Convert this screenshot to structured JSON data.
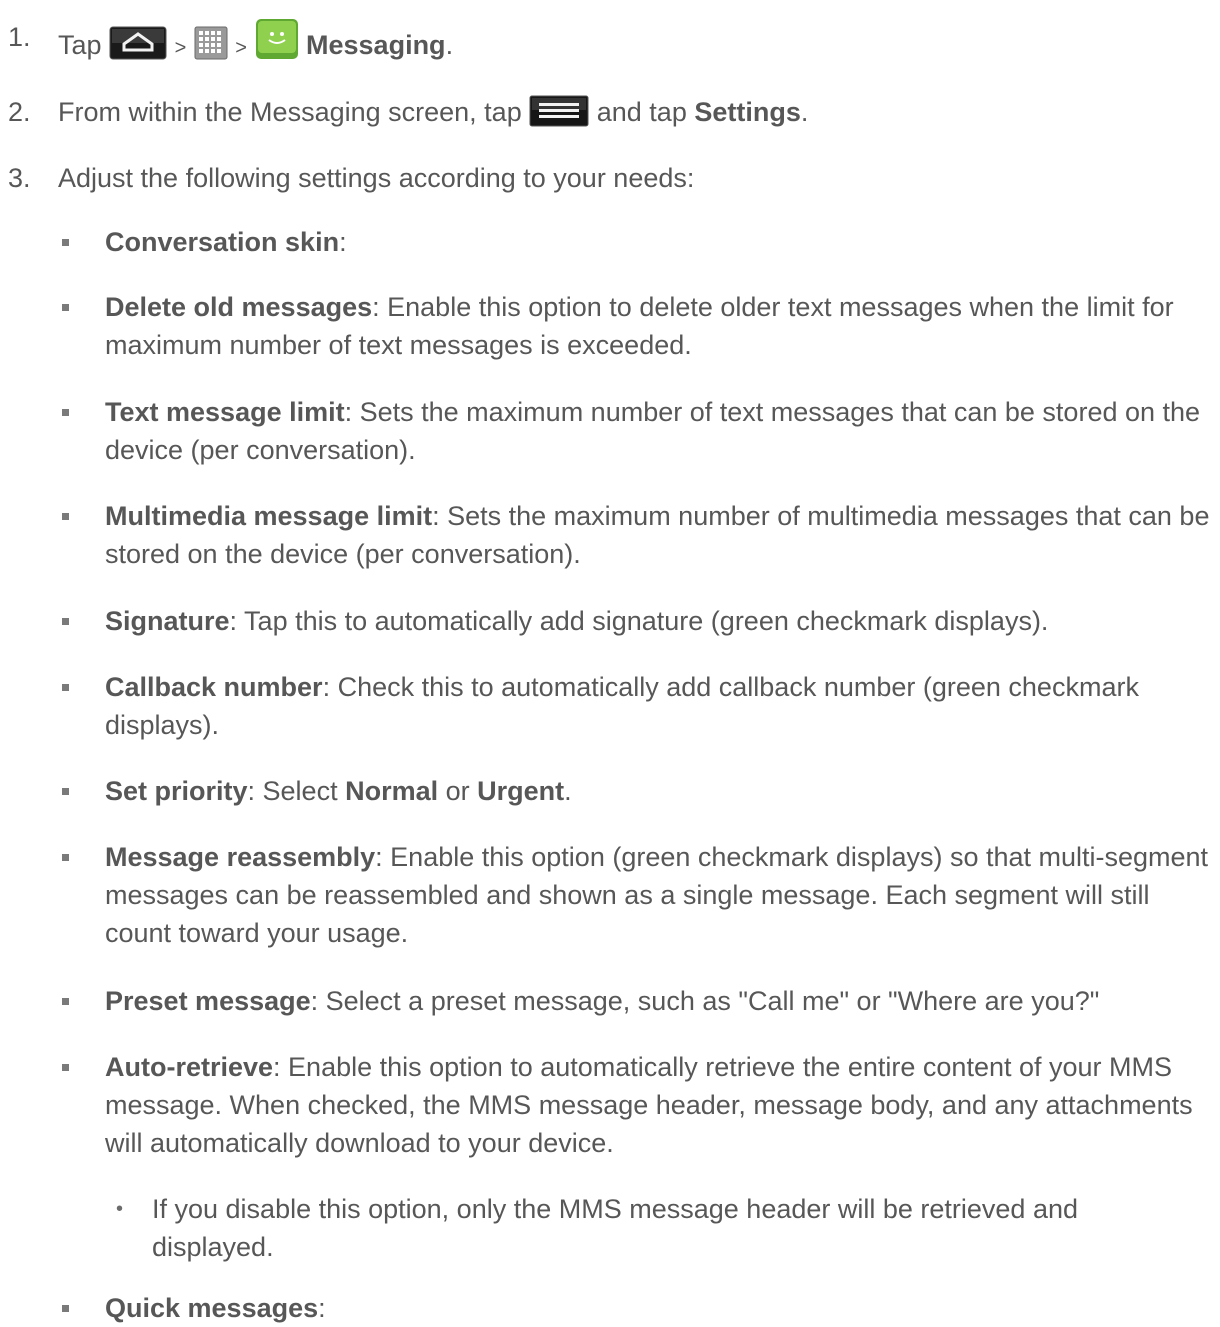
{
  "steps": {
    "s1": {
      "num": "1.",
      "pre": "Tap",
      "gt1": ">",
      "gt2": ">",
      "bold": "Messaging",
      "post": "."
    },
    "s2": {
      "num": "2.",
      "pre": "From within the Messaging screen, tap",
      "mid": "and tap",
      "bold": "Settings",
      "post": "."
    },
    "s3": {
      "num": "3.",
      "text": "Adjust the following settings according to your needs:"
    }
  },
  "settings": [
    {
      "title": "Conversation skin",
      "desc": ":"
    },
    {
      "title": "Delete old messages",
      "desc": ": Enable this option to delete older text messages when the limit for maximum number of text messages is exceeded."
    },
    {
      "title": "Text message limit",
      "desc": ": Sets the maximum number of text messages that can be stored on the device (per conversation)."
    },
    {
      "title": "Multimedia message limit",
      "desc": ": Sets the maximum number of multimedia messages that can be stored on the device (per conversation)."
    },
    {
      "title": "Signature",
      "desc": ": Tap this to automatically add signature (green checkmark displays)."
    },
    {
      "title": "Callback number",
      "desc": ": Check this to automatically add callback number (green checkmark displays)."
    },
    {
      "title": "Set priority",
      "desc": ": Select ",
      "b1": "Normal",
      "mid": " or ",
      "b2": "Urgent",
      "end": "."
    },
    {
      "title": "Message reassembly",
      "desc": ": Enable this option (green checkmark displays) so that multi-segment messages can be reassembled and shown as a single message. Each segment will still count toward your usage."
    },
    {
      "title": "Preset message",
      "desc": ": Select a preset message, such as \"Call me\" or \"Where are you?\""
    },
    {
      "title": "Auto-retrieve",
      "desc": ": Enable this option to automatically retrieve the entire content of your MMS message. When checked, the MMS message header, message body, and any attachments will automatically download to your device."
    },
    {
      "title": "Quick messages",
      "desc": ":"
    }
  ],
  "auto_retrieve_note": {
    "bullet": "•",
    "text": "If you disable this option, only the MMS message header will be retrieved and displayed."
  },
  "icons": {
    "home": "home-icon",
    "apps": "apps-grid-icon",
    "messaging": "messaging-app-icon",
    "menu": "menu-icon"
  },
  "colors": {
    "text": "#575757",
    "bullet": "#7a7a7a",
    "messaging_green": "#7cc242"
  }
}
